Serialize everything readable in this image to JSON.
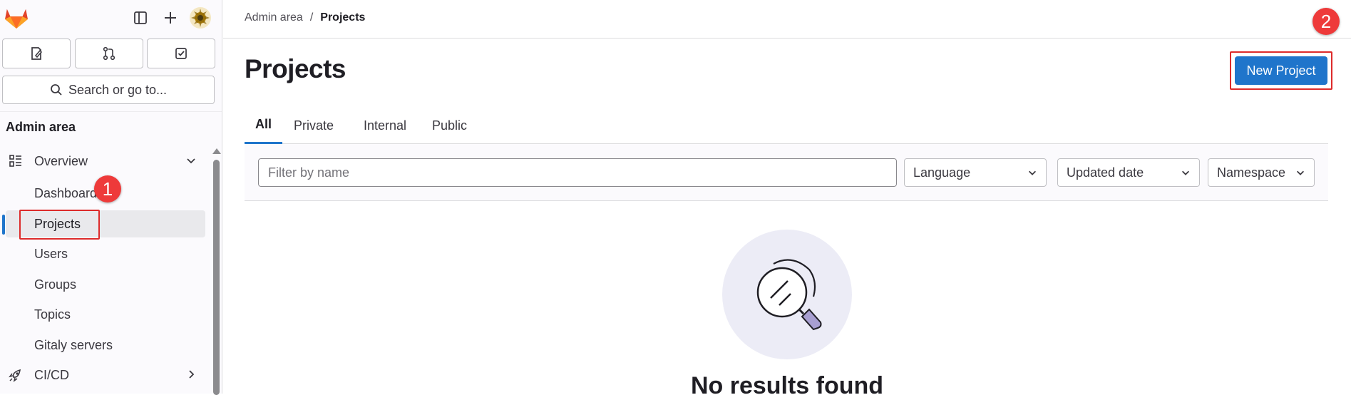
{
  "colors": {
    "accent": "#1f75cb",
    "marker": "#ee3a3a",
    "highlight": "#dd2b2b",
    "logo": "#e24329"
  },
  "sidebar": {
    "search_label": "Search or go to...",
    "section_title": "Admin area",
    "overview": {
      "label": "Overview",
      "icon": "overview-icon"
    },
    "sub_items": [
      "Dashboard",
      "Projects",
      "Users",
      "Groups",
      "Topics",
      "Gitaly servers"
    ],
    "cicd": {
      "label": "CI/CD",
      "icon": "rocket-icon"
    }
  },
  "breadcrumb": {
    "parent": "Admin area",
    "separator": "/",
    "current": "Projects"
  },
  "page": {
    "title": "Projects",
    "new_button": "New Project"
  },
  "tabs": [
    "All",
    "Private",
    "Internal",
    "Public"
  ],
  "active_tab": "All",
  "filters": {
    "name_placeholder": "Filter by name",
    "language": "Language",
    "sort": "Updated date",
    "namespace": "Namespace"
  },
  "empty_state": {
    "title": "No results found"
  },
  "annotations": {
    "marker_1": "1",
    "marker_2": "2"
  }
}
